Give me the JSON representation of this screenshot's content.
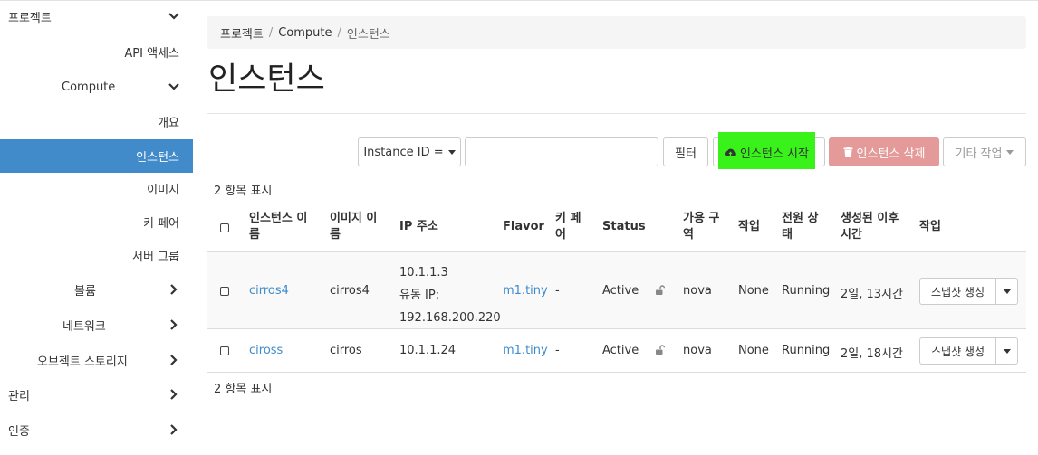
{
  "sidebar": {
    "project": "프로젝트",
    "api_access": "API 액세스",
    "compute": "Compute",
    "overview": "개요",
    "instances": "인스턴스",
    "images": "이미지",
    "key_pairs": "키 페어",
    "server_groups": "서버 그룹",
    "volumes": "볼륨",
    "network": "네트워크",
    "object_storage": "오브젝트 스토리지",
    "admin": "관리",
    "identity": "인증"
  },
  "breadcrumb": {
    "items": [
      "프로젝트",
      "Compute",
      "인스턴스"
    ],
    "separator": "/"
  },
  "page": {
    "title": "인스턴스"
  },
  "toolbar": {
    "filter_field": "Instance ID =",
    "filter_value": "",
    "filter_button": "필터",
    "launch_button": "인스턴스 시작",
    "delete_button": "인스턴스 삭제",
    "more_actions": "기타 작업"
  },
  "count_label": "2 항목 표시",
  "table": {
    "headers": {
      "name": [
        "인스턴스 이",
        "름"
      ],
      "image": [
        "이미지 이",
        "름"
      ],
      "ip": "IP 주소",
      "flavor": "Flavor",
      "keypair": [
        "키 페",
        "어"
      ],
      "status": "Status",
      "az": [
        "가용 구",
        "역"
      ],
      "task": "작업",
      "power": [
        "전원 상",
        "태"
      ],
      "age": [
        "생성된 이후",
        "시간"
      ],
      "actions": "작업"
    },
    "rows": [
      {
        "name": "cirros4",
        "image": "cirros4",
        "ip_lines": [
          "10.1.1.3",
          "유동 IP:",
          "192.168.200.220"
        ],
        "flavor": "m1.tiny",
        "keypair": "-",
        "status": "Active",
        "az": "nova",
        "task": "None",
        "power": "Running",
        "age": "2일, 13시간",
        "action": "스냅샷 생성"
      },
      {
        "name": "ciross",
        "image": "cirros",
        "ip_lines": [
          "10.1.1.24"
        ],
        "flavor": "m1.tiny",
        "keypair": "-",
        "status": "Active",
        "az": "nova",
        "task": "None",
        "power": "Running",
        "age": "2일, 18시간",
        "action": "스냅샷 생성"
      }
    ]
  },
  "colors": {
    "accent": "#428bca",
    "highlight": "#39f21a",
    "danger": "#e59a9a"
  },
  "icons": {
    "chevron_down": "chevron-down-icon",
    "chevron_right": "chevron-right-icon",
    "cloud_upload": "cloud-upload-icon",
    "trash": "trash-icon",
    "lock": "lock-icon"
  }
}
